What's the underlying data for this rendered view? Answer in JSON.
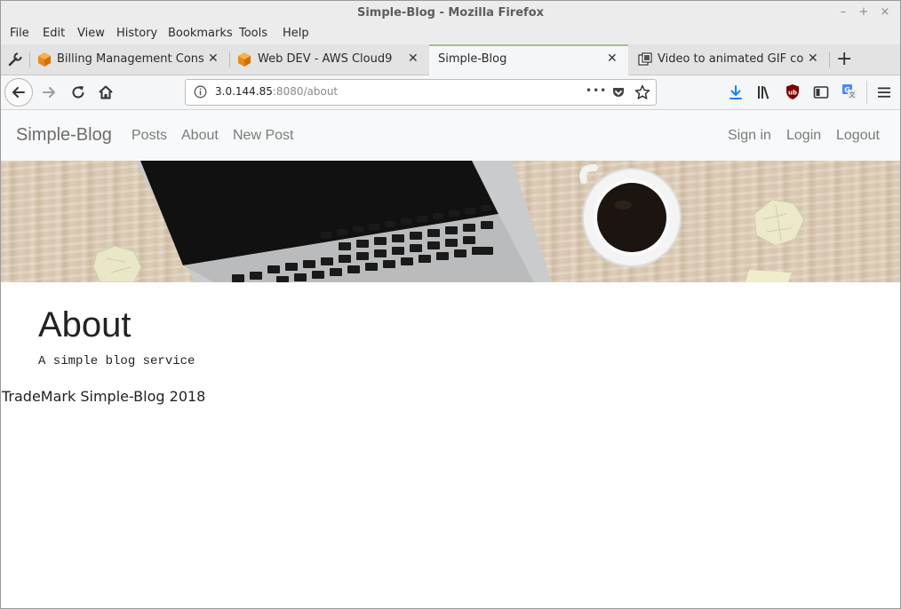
{
  "window": {
    "title": "Simple-Blog - Mozilla Firefox",
    "controls": {
      "minimize": "–",
      "maximize": "+",
      "close": "×"
    }
  },
  "menu": {
    "items": [
      {
        "label": "File"
      },
      {
        "label": "Edit"
      },
      {
        "label": "View"
      },
      {
        "label": "History"
      },
      {
        "label": "Bookmarks"
      },
      {
        "label": "Tools"
      },
      {
        "label": "Help"
      }
    ]
  },
  "tabs": [
    {
      "label": "Billing Management Console",
      "icon": "aws-cube-icon"
    },
    {
      "label": "Web DEV - AWS Cloud9",
      "icon": "aws-cube-icon"
    },
    {
      "label": "Simple-Blog",
      "active": true
    },
    {
      "label": "Video to animated GIF conver",
      "icon": "converter-icon"
    }
  ],
  "tab_close_glyph": "✕",
  "new_tab_glyph": "+",
  "address": {
    "host": "3.0.144.85",
    "rest": ":8080/about",
    "dots": "•••"
  },
  "site": {
    "brand": "Simple-Blog",
    "nav_left": [
      "Posts",
      "About",
      "New Post"
    ],
    "nav_right": [
      "Sign in",
      "Login",
      "Logout"
    ]
  },
  "content": {
    "heading": "About",
    "description": "A simple blog service",
    "footer": "TradeMark Simple-Blog 2018"
  },
  "colors": {
    "accent_tab": "#a3c08c",
    "download_arrow": "#0a84ff",
    "ublock": "#800000",
    "aws_orange": "#f49b23"
  }
}
